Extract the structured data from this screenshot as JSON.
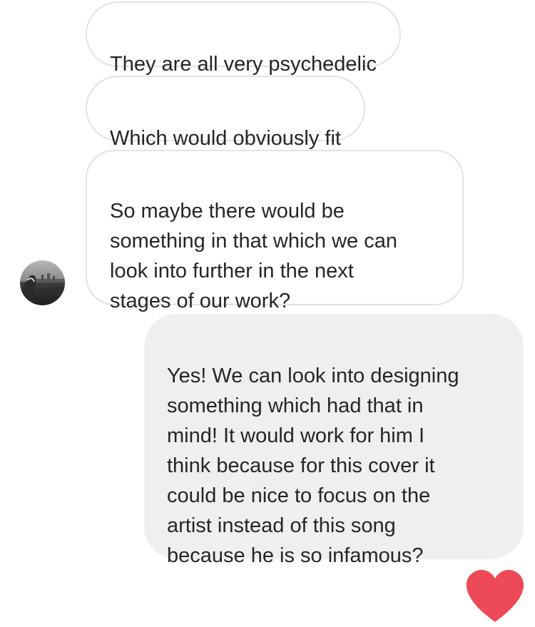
{
  "thread": {
    "messages": [
      {
        "sender": "other",
        "text": "They are all very psychedelic"
      },
      {
        "sender": "other",
        "text": "Which would obviously fit"
      },
      {
        "sender": "other",
        "text": "So maybe there would be\nsomething in that which we can\nlook into further in the next\nstages of our work?"
      },
      {
        "sender": "me",
        "text": "Yes! We can look into designing\nsomething which had that in\nmind! It would work for him I\nthink because for this cover it\ncould be nice to focus on the\nartist instead of this song\nbecause he is so infamous?"
      }
    ]
  },
  "colors": {
    "received_border": "#e3e3e3",
    "sent_background": "#efefef",
    "text": "#262626",
    "heart": "#ed4956"
  },
  "icons": {
    "avatar": "profile-photo-avatar",
    "reaction": "heart-icon"
  }
}
